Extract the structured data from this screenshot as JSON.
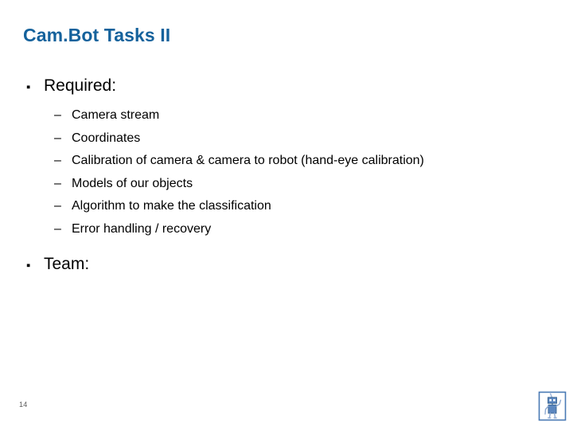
{
  "slide": {
    "title": "Cam.Bot Tasks II",
    "page_number": "14",
    "title_color": "#15629C",
    "body_text_color": "#000000",
    "background_color": "#FFFFFF",
    "page_number_color": "#5A5A5A",
    "logo_color": "#4A7AB5"
  },
  "content": {
    "sections": [
      {
        "bullet_glyph": "▪",
        "heading": "Required:",
        "items": [
          {
            "dash": "–",
            "label": "Camera stream"
          },
          {
            "dash": "–",
            "label": "Coordinates"
          },
          {
            "dash": "–",
            "label": "Calibration of camera & camera to robot (hand-eye calibration)"
          },
          {
            "dash": "–",
            "label": "Models of our objects"
          },
          {
            "dash": "–",
            "label": "Algorithm to make the classification"
          },
          {
            "dash": "–",
            "label": "Error handling / recovery"
          }
        ]
      },
      {
        "bullet_glyph": "▪",
        "heading": "Team:",
        "items": []
      }
    ]
  },
  "logo": {
    "name": "robot-logo",
    "description": "blue square outline containing a waving robot figure"
  }
}
